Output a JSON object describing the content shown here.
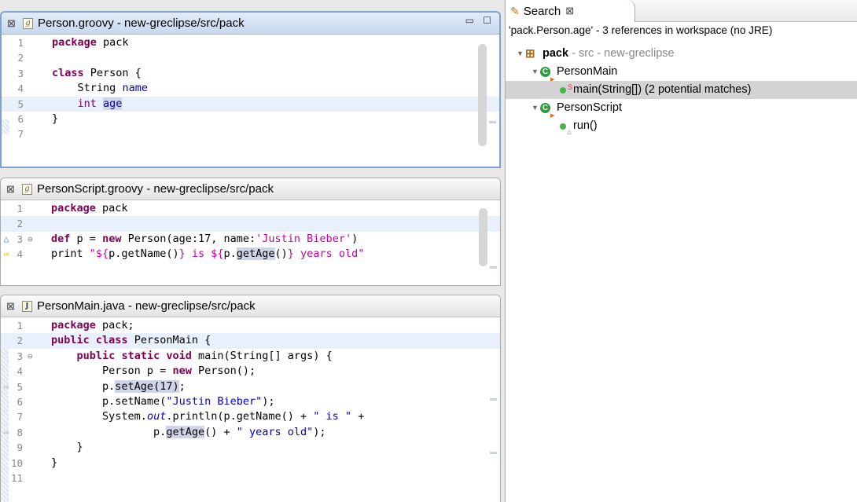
{
  "window_controls": "▭ ☐",
  "editors": [
    {
      "file_icon": "g",
      "title": "Person.groovy - new-greclipse/src/pack",
      "lines": [
        "1",
        "2",
        "3",
        "4",
        "5",
        "6",
        "7"
      ]
    },
    {
      "file_icon": "g",
      "title": "PersonScript.groovy - new-greclipse/src/pack",
      "lines": [
        "1",
        "2",
        "3",
        "4"
      ]
    },
    {
      "file_icon": "J",
      "title": "PersonMain.java - new-greclipse/src/pack",
      "lines": [
        "1",
        "2",
        "3",
        "4",
        "5",
        "6",
        "7",
        "8",
        "9",
        "10",
        "11"
      ]
    }
  ],
  "code": {
    "package_kw": "package",
    "pack": "pack",
    "pack_semi": "pack;",
    "class_kw": "class",
    "person_open": "Person {",
    "string_type": "String",
    "name_field": "name",
    "int_kw": "int",
    "age_field": "age",
    "close_brace": "}",
    "def_kw": "def",
    "p_assign": "p =",
    "new_kw": "new",
    "person_call_a": "Person(age:17, name:",
    "justin_single": "'Justin Bieber'",
    "close_paren": ")",
    "print_kw": "print",
    "gstr_1": "\"${",
    "p_getname": "p.getName()",
    "gstr_2": "} is ${",
    "p_dot": "p.",
    "getage": "getAge",
    "paren_pair": "()",
    "gstr_3": "} years old\"",
    "public_kw": "public",
    "static_kw": "static",
    "void_kw": "void",
    "personmain_open": "PersonMain {",
    "main_sig": "main(String[] args) {",
    "person_p_eq": "Person p =",
    "person_ctor": "Person();",
    "setage_call": "setAge(17)",
    "semi": ";",
    "setname_a": "p.setName(",
    "justin_double": "\"Justin Bieber\"",
    "close_semi": ");",
    "system_dot": "System.",
    "out": "out",
    "println_a": ".println(p.getName() +",
    "is_str": "\" is \"",
    "plus": "+",
    "p_getage_plus": "() +",
    "years_str": "\" years old\""
  },
  "search_view": {
    "tab_label": "Search",
    "result_summary": "'pack.Person.age' - 3 references in workspace (no JRE)",
    "tree": {
      "package_name": "pack",
      "package_detail": "- src - new-greclipse",
      "class_main": "PersonMain",
      "main_match": "main(String[]) (2 potential matches)",
      "class_script": "PersonScript",
      "run_match": "run()"
    }
  }
}
